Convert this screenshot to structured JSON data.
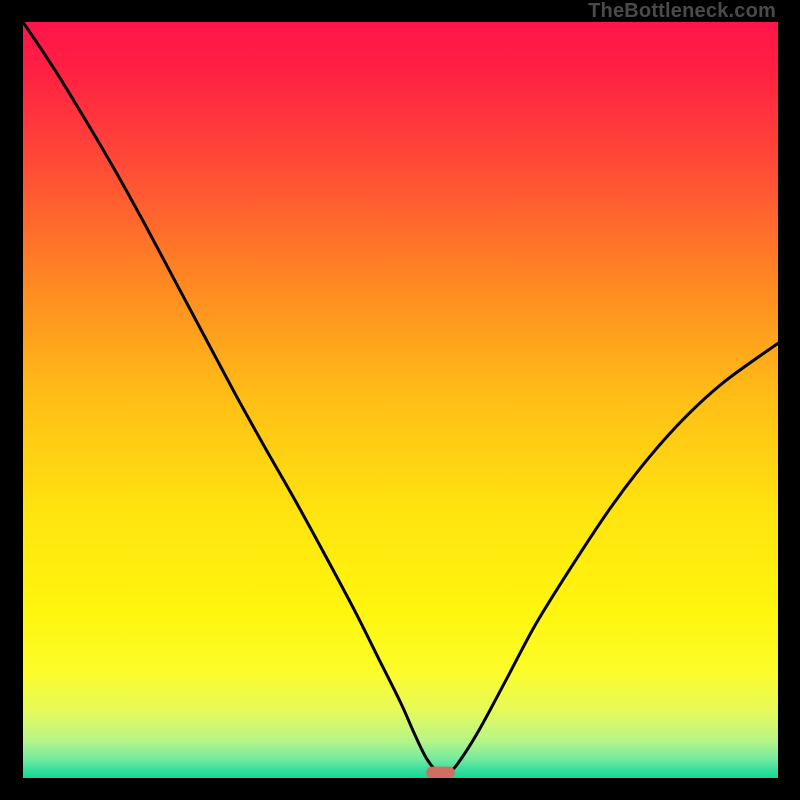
{
  "watermark": "TheBottleneck.com",
  "chart_data": {
    "type": "line",
    "title": "",
    "xlabel": "",
    "ylabel": "",
    "xlim": [
      0,
      100
    ],
    "ylim": [
      0,
      100
    ],
    "note": "Axes and ticks are not shown; a single black curve forms a V with minimum near x≈55; background is a vertical rainbow gradient (red→yellow→green) on a black frame.",
    "gradient_stops": [
      {
        "offset": 0.0,
        "color": "#ff1549"
      },
      {
        "offset": 0.06,
        "color": "#ff1f44"
      },
      {
        "offset": 0.2,
        "color": "#ff4f35"
      },
      {
        "offset": 0.35,
        "color": "#ff8a22"
      },
      {
        "offset": 0.5,
        "color": "#ffbf16"
      },
      {
        "offset": 0.65,
        "color": "#ffe40f"
      },
      {
        "offset": 0.78,
        "color": "#fff60e"
      },
      {
        "offset": 0.86,
        "color": "#fbfc2a"
      },
      {
        "offset": 0.91,
        "color": "#e7fa5a"
      },
      {
        "offset": 0.95,
        "color": "#b8f587"
      },
      {
        "offset": 0.975,
        "color": "#74eaa0"
      },
      {
        "offset": 0.99,
        "color": "#35dd9e"
      },
      {
        "offset": 1.0,
        "color": "#12d893"
      }
    ],
    "curve": {
      "x": [
        0,
        4,
        8,
        12,
        16,
        20,
        24,
        28,
        32,
        36,
        40,
        44,
        47,
        50,
        52,
        53.5,
        55,
        56.5,
        58,
        60.5,
        64,
        68,
        73,
        78,
        83,
        88,
        93,
        100
      ],
      "y": [
        100,
        94.0,
        87.5,
        80.7,
        73.5,
        66.0,
        58.5,
        51.0,
        43.8,
        36.8,
        29.5,
        22.0,
        16.0,
        10.0,
        5.5,
        2.5,
        0.8,
        0.8,
        2.5,
        6.5,
        13.0,
        20.5,
        28.5,
        36.0,
        42.5,
        48.0,
        52.5,
        57.5
      ]
    },
    "marker": {
      "x": 55.3,
      "y": 0.75,
      "width_pct": 3.8,
      "height_pct": 1.5,
      "color": "#cf6f63"
    }
  }
}
